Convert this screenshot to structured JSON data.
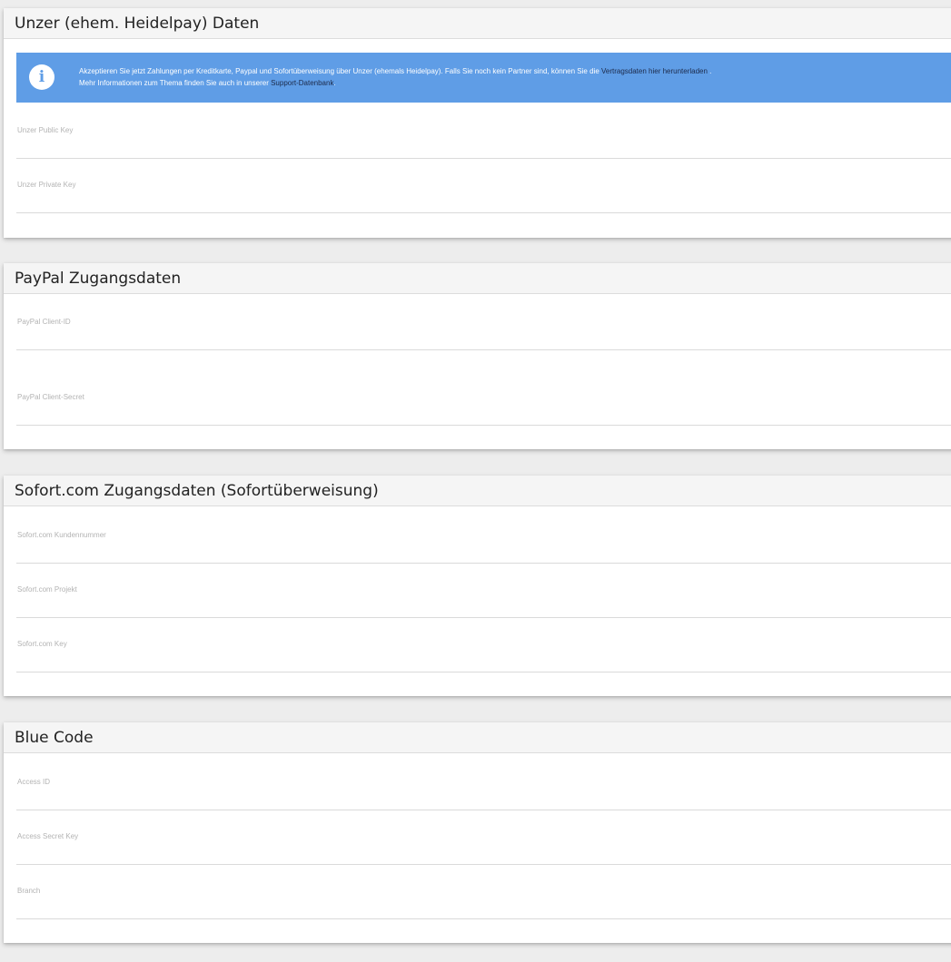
{
  "sections": {
    "unzer": {
      "title": "Unzer (ehem. Heidelpay) Daten",
      "info": {
        "icon": "info-icon",
        "line1_prefix": "Akzeptieren Sie jetzt Zahlungen per Kreditkarte, Paypal und Sofortüberweisung über Unzer (ehemals Heidelpay). Falls Sie noch kein Partner sind, können Sie die ",
        "line1_link": "Vertragsdaten hier herunterladen",
        "line1_suffix": " .",
        "line2_prefix": "Mehr Informationen zum Thema finden Sie auch in unserer ",
        "line2_link": "Support-Datenbank",
        "line2_suffix": ".",
        "background_color": "#5f9de6"
      },
      "fields": [
        {
          "label": "Unzer Public Key",
          "value": ""
        },
        {
          "label": "Unzer Private Key",
          "value": ""
        }
      ]
    },
    "paypal": {
      "title": "PayPal Zugangsdaten",
      "fields": [
        {
          "label": "PayPal Client-ID",
          "value": ""
        },
        {
          "label": "PayPal Client-Secret",
          "value": ""
        }
      ]
    },
    "sofort": {
      "title": "Sofort.com Zugangsdaten (Sofortüberweisung)",
      "fields": [
        {
          "label": "Sofort.com Kundennummer",
          "value": ""
        },
        {
          "label": "Sofort.com Projekt",
          "value": ""
        },
        {
          "label": "Sofort.com Key",
          "value": ""
        }
      ]
    },
    "bluecode": {
      "title": "Blue Code",
      "fields": [
        {
          "label": "Access ID",
          "value": ""
        },
        {
          "label": "Access Secret Key",
          "value": ""
        },
        {
          "label": "Branch",
          "value": ""
        }
      ]
    }
  }
}
